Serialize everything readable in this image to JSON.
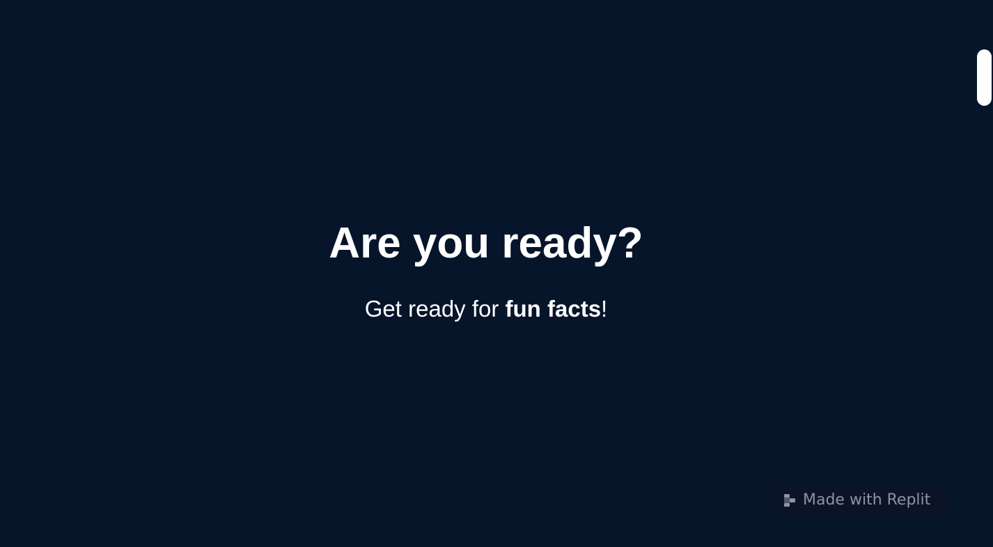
{
  "hero": {
    "title": "Are you ready?",
    "subtitle_prefix": "Get ready for ",
    "subtitle_emphasis": "fun facts",
    "subtitle_suffix": "!"
  },
  "badge": {
    "label": "Made with Replit",
    "icon": "replit-logo-icon"
  },
  "colors": {
    "background": "#07152b",
    "text": "#ffffff",
    "badge_background": "#0b1327",
    "badge_text": "#8b93a6"
  }
}
